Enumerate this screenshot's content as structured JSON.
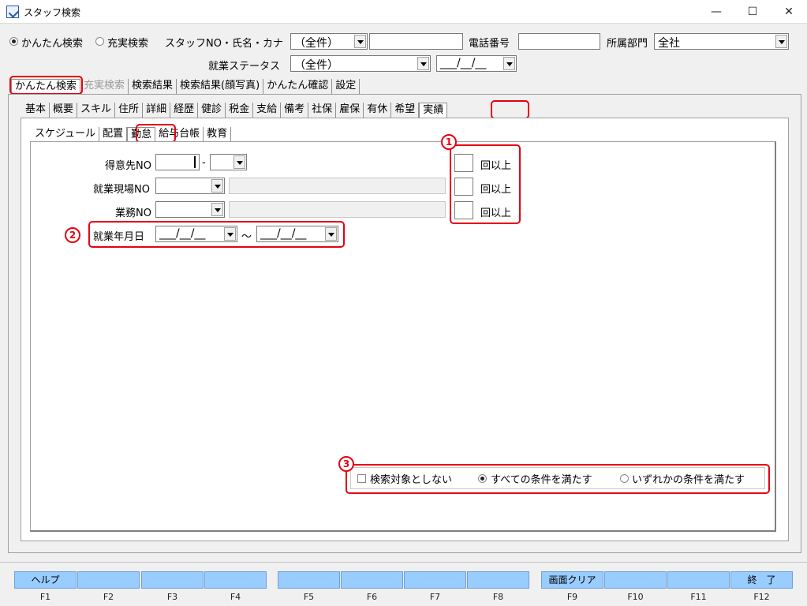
{
  "window": {
    "title": "スタッフ検索",
    "minimize": "—",
    "maximize": "☐",
    "close": "✕"
  },
  "search_mode": {
    "simple_label": "かんたん検索",
    "full_label": "充実検索",
    "selected": "simple"
  },
  "top_fields": {
    "staff_label": "スタッフNO・氏名・カナ",
    "staff_combo_value": "（全件）",
    "staff_text_value": "",
    "phone_label": "電話番号",
    "phone_value": "",
    "dept_label": "所属部門",
    "dept_value": "全社",
    "status_label": "就業ステータス",
    "status_value": "（全件）",
    "date_value": "___/__/__"
  },
  "main_tabs": [
    "かんたん検索",
    "充実検索",
    "検索結果",
    "検索結果(顔写真)",
    "かんたん確認",
    "設定"
  ],
  "sub_tabs": [
    "基本",
    "概要",
    "スキル",
    "住所",
    "詳細",
    "経歴",
    "健診",
    "税金",
    "支給",
    "備考",
    "社保",
    "雇保",
    "有休",
    "希望",
    "実績"
  ],
  "inner_tabs": [
    "スケジュール",
    "配置",
    "勤怠",
    "給与台帳",
    "教育"
  ],
  "form": {
    "customer_label": "得意先NO",
    "customer_sep": "-",
    "site_label": "就業現場NO",
    "work_label": "業務NO",
    "count_suffix": "回以上",
    "period_label": "就業年月日",
    "date_from": "___/__/__",
    "date_to": "___/__/__",
    "range_sep": "～"
  },
  "conditions": {
    "exclude_label": "検索対象としない",
    "all_label": "すべての条件を満たす",
    "any_label": "いずれかの条件を満たす",
    "selected": "all"
  },
  "annotations": {
    "one": "1",
    "two": "2",
    "three": "3"
  },
  "colors": {
    "highlight": "#e60012",
    "fkey": "#99ccff"
  },
  "function_keys": [
    {
      "key": "F1",
      "label": "ヘルプ"
    },
    {
      "key": "F2",
      "label": ""
    },
    {
      "key": "F3",
      "label": ""
    },
    {
      "key": "F4",
      "label": ""
    },
    {
      "key": "F5",
      "label": ""
    },
    {
      "key": "F6",
      "label": ""
    },
    {
      "key": "F7",
      "label": ""
    },
    {
      "key": "F8",
      "label": ""
    },
    {
      "key": "F9",
      "label": "画面クリア"
    },
    {
      "key": "F10",
      "label": ""
    },
    {
      "key": "F11",
      "label": ""
    },
    {
      "key": "F12",
      "label": "終　了"
    }
  ]
}
